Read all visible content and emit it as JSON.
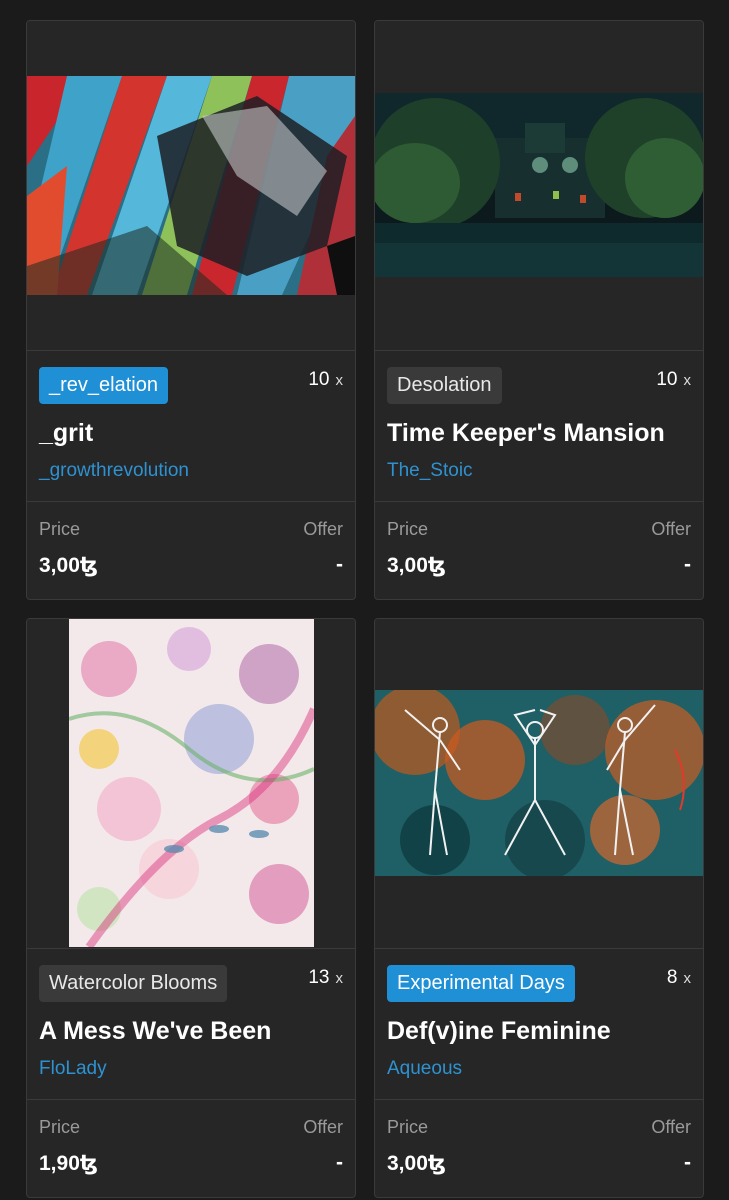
{
  "cards": [
    {
      "tag": "_rev_elation",
      "edition_count": "10",
      "edition_suffix": "x",
      "title": "_grit",
      "artist": "_growthrevolution",
      "price_label": "Price",
      "price_value": "3,00ꜩ",
      "offer_label": "Offer",
      "offer_value": "-"
    },
    {
      "tag": "Desolation",
      "edition_count": "10",
      "edition_suffix": "x",
      "title": "Time Keeper's Mansion",
      "artist": "The_Stoic",
      "price_label": "Price",
      "price_value": "3,00ꜩ",
      "offer_label": "Offer",
      "offer_value": "-"
    },
    {
      "tag": "Watercolor Blooms",
      "edition_count": "13",
      "edition_suffix": "x",
      "title": "A Mess We've Been",
      "artist": "FloLady",
      "price_label": "Price",
      "price_value": "1,90ꜩ",
      "offer_label": "Offer",
      "offer_value": "-"
    },
    {
      "tag": "Experimental Days",
      "edition_count": "8",
      "edition_suffix": "x",
      "title": "Def(v)ine Feminine",
      "artist": "Aqueous",
      "price_label": "Price",
      "price_value": "3,00ꜩ",
      "offer_label": "Offer",
      "offer_value": "-"
    }
  ],
  "colors": {
    "background": "#1b1b1b",
    "card": "#262626",
    "tag_highlight": "#1f8fd6",
    "tag_default": "#3a3a3a",
    "artist_link": "#2e92d1",
    "muted": "#9a9a9a"
  }
}
